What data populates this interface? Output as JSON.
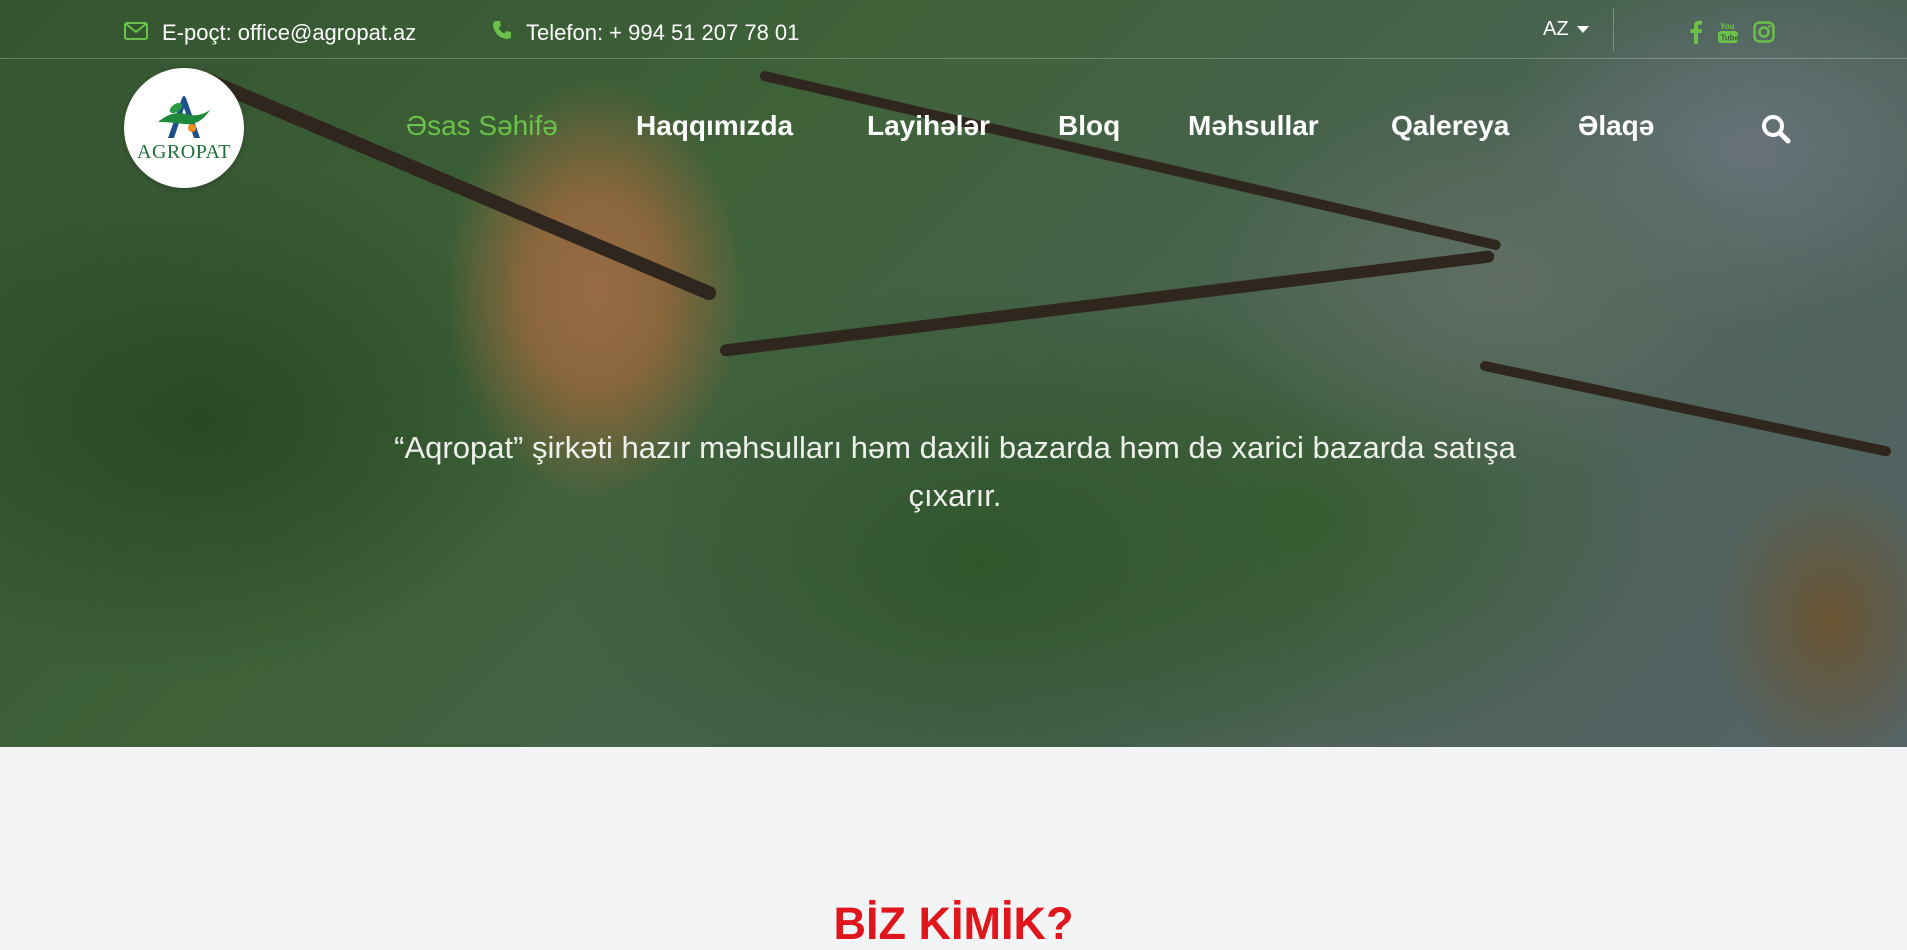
{
  "topbar": {
    "email_label": "E-poçt: office@agropat.az",
    "phone_label": "Telefon: + 994 51 207 78 01",
    "language": "AZ",
    "icons": [
      "envelope-icon",
      "phone-icon",
      "facebook-icon",
      "youtube-icon",
      "instagram-icon"
    ],
    "accent_color": "#6bc24a"
  },
  "logo": {
    "text": "AGROPAT"
  },
  "nav": {
    "items": [
      {
        "label": "Əsas Səhifə",
        "active": true
      },
      {
        "label": "Haqqımızda"
      },
      {
        "label": "Layihələr"
      },
      {
        "label": "Bloq"
      },
      {
        "label": "Məhsullar"
      },
      {
        "label": "Qalereya"
      },
      {
        "label": "Əlaqə"
      }
    ]
  },
  "hero": {
    "caption": "“Aqropat” şirkəti hazır məhsulları həm daxili bazarda həm də xarici bazarda satışa çıxarır."
  },
  "about": {
    "title": "BİZ KİMİK?",
    "title_color": "#e0161c"
  }
}
